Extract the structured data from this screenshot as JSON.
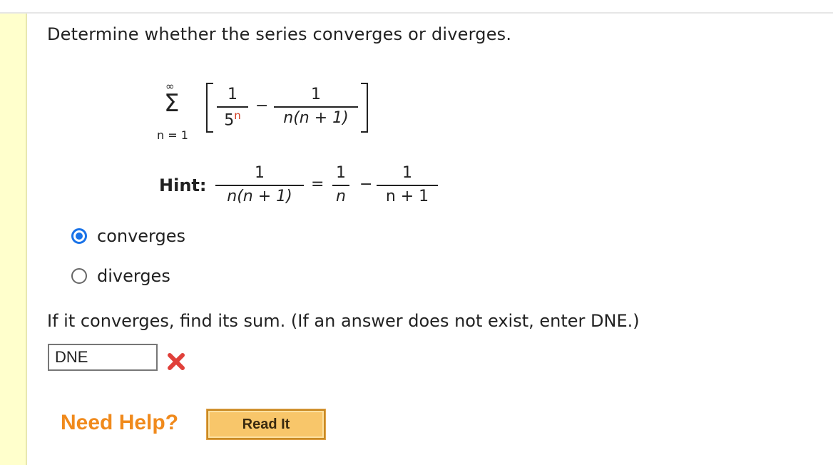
{
  "question": "Determine whether the series converges or diverges.",
  "series": {
    "sum_symbol": "Σ",
    "upper": "∞",
    "lower": "n = 1",
    "term1_num": "1",
    "term1_den_base": "5",
    "term1_den_exp": "n",
    "minus": "−",
    "term2_num": "1",
    "term2_den": "n(n + 1)"
  },
  "hint": {
    "label": "Hint:",
    "lhs_num": "1",
    "lhs_den": "n(n + 1)",
    "equals": "=",
    "r1_num": "1",
    "r1_den": "n",
    "minus": "−",
    "r2_num": "1",
    "r2_den": "n + 1"
  },
  "options": [
    {
      "label": "converges",
      "checked": true
    },
    {
      "label": "diverges",
      "checked": false
    }
  ],
  "sum_prompt": "If it converges, find its sum. (If an answer does not exist, enter DNE.)",
  "answer_value": "DNE",
  "answer_status_icon": "incorrect-x-icon",
  "help": {
    "label": "Need Help?",
    "read_it_label": "Read It"
  },
  "colors": {
    "accent_radio": "#1a73e8",
    "incorrect": "#e0403a",
    "help_text": "#f08a1c",
    "read_it_bg": "#f8c66a",
    "exponent_red": "#d03a1e",
    "left_bar": "#ffffcc"
  }
}
